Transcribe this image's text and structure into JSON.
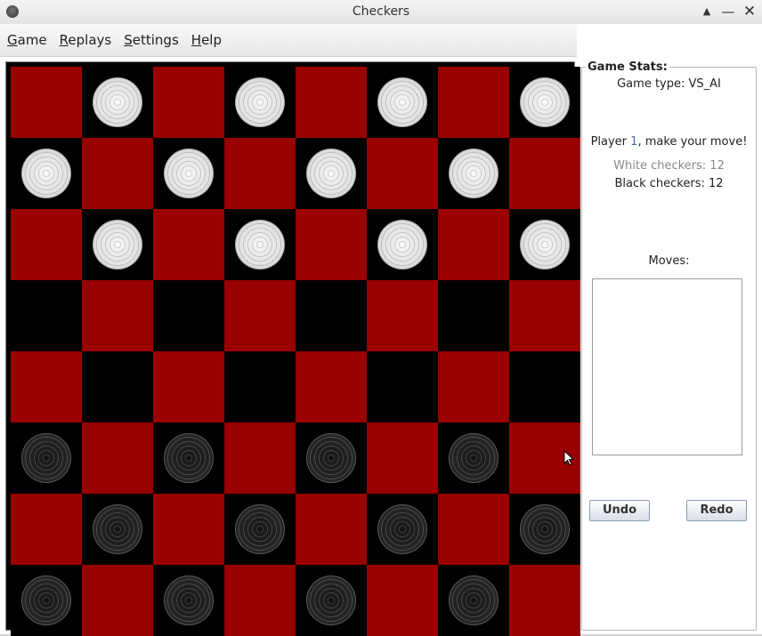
{
  "window": {
    "title": "Checkers"
  },
  "menu": [
    {
      "mnemonic": "G",
      "rest": "ame"
    },
    {
      "mnemonic": "R",
      "rest": "eplays"
    },
    {
      "mnemonic": "S",
      "rest": "ettings"
    },
    {
      "mnemonic": "H",
      "rest": "elp"
    }
  ],
  "board": {
    "rows": 8,
    "cols": 8,
    "colors": {
      "light_square": "#990000",
      "dark_square": "#000000"
    },
    "pieces": [
      [
        "",
        "w",
        "",
        "w",
        "",
        "w",
        "",
        "w"
      ],
      [
        "w",
        "",
        "w",
        "",
        "w",
        "",
        "w",
        ""
      ],
      [
        "",
        "w",
        "",
        "w",
        "",
        "w",
        "",
        "w"
      ],
      [
        "",
        "",
        "",
        "",
        "",
        "",
        "",
        ""
      ],
      [
        "",
        "",
        "",
        "",
        "",
        "",
        "",
        ""
      ],
      [
        "b",
        "",
        "b",
        "",
        "b",
        "",
        "b",
        ""
      ],
      [
        "",
        "b",
        "",
        "b",
        "",
        "b",
        "",
        "b"
      ],
      [
        "b",
        "",
        "b",
        "",
        "b",
        "",
        "b",
        ""
      ]
    ]
  },
  "stats": {
    "legend": "Game Stats:",
    "game_type": "Game type: VS_AI",
    "prompt_prefix": "Player ",
    "player_number": "1",
    "prompt_suffix": ", make your move!",
    "white_checkers": "White checkers: 12",
    "black_checkers": "Black checkers: 12",
    "moves_label": "Moves:",
    "moves": []
  },
  "buttons": {
    "undo": "Undo",
    "redo": "Redo"
  }
}
